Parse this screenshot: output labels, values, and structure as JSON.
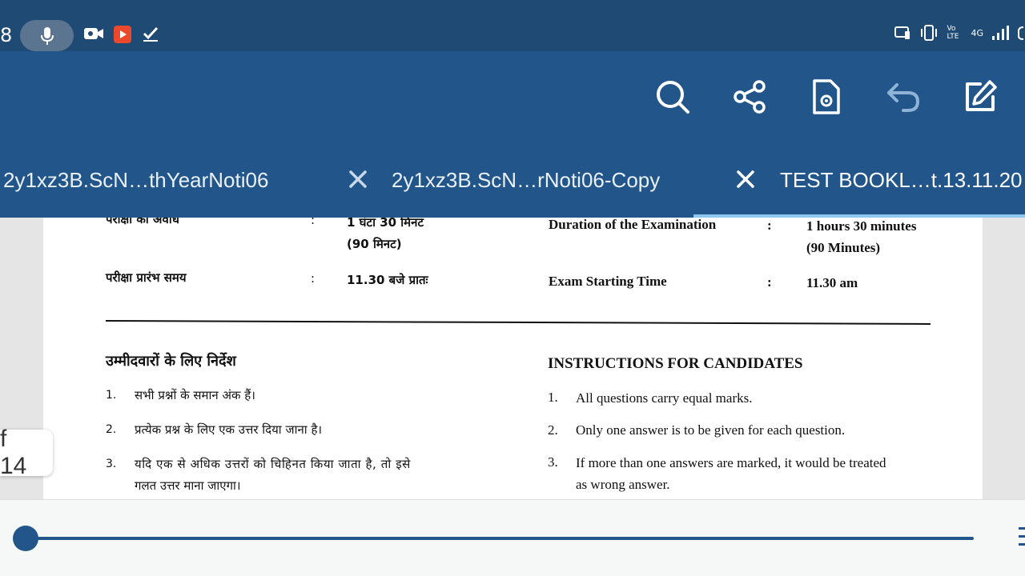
{
  "status_bar": {
    "time_fragment": "8",
    "left_icons": [
      "mic-icon",
      "video-camera-icon",
      "youtube-icon",
      "check-icon"
    ],
    "right_text": {
      "volte": "Vo LTE",
      "network": "4G"
    }
  },
  "toolbar": {
    "actions": [
      "search-icon",
      "share-icon",
      "document-settings-icon",
      "undo-icon",
      "edit-icon"
    ]
  },
  "tabs": [
    {
      "label": "2y1xz3B.ScN…thYearNoti06"
    },
    {
      "label": "2y1xz3B.ScN…rNoti06-Copy"
    },
    {
      "label": "TEST BOOKL…t.13.11.20"
    }
  ],
  "document": {
    "hindi": {
      "duration_label": "परीक्षा की अवधि",
      "duration_value_1": "1 घंटा 30 मिनट",
      "duration_value_2": "(90 मिनट)",
      "start_label": "परीक्षा प्रारंभ समय",
      "start_value": "11.30 बजे प्रातः",
      "colon": ":",
      "instructions_heading": "उम्मीदवारों के लिए निर्देश",
      "items": [
        {
          "num": "1.",
          "text": "सभी प्रश्नों के समान अंक हैं।"
        },
        {
          "num": "2.",
          "text": "प्रत्येक प्रश्न के लिए एक उत्तर दिया जाना है।"
        },
        {
          "num": "3.",
          "text": "यदि एक से अधिक उत्तरों को चिहिनत किया जाता है, तो इसे",
          "text2": "गलत उत्तर माना जाएगा।"
        }
      ]
    },
    "english": {
      "duration_label": "Duration of the Examination",
      "duration_value_1": "1 hours 30 minutes",
      "duration_value_2": "(90 Minutes)",
      "start_label": "Exam Starting Time",
      "start_value": "11.30 am",
      "colon": ":",
      "instructions_heading": "INSTRUCTIONS FOR CANDIDATES",
      "items": [
        {
          "num": "1.",
          "text": "All questions carry equal marks."
        },
        {
          "num": "2.",
          "text": "Only one answer is to be given for each question."
        },
        {
          "num": "3.",
          "text": "If more than one answers are marked, it would be treated",
          "text2": "as wrong answer."
        }
      ]
    }
  },
  "page_counter": "f 14",
  "scrubber": {
    "progress": 0.0
  },
  "colors": {
    "status_bar": "#1f4a73",
    "toolbar": "#22568a",
    "accent": "#22568a",
    "tab_underline": "#8fc6ef"
  }
}
